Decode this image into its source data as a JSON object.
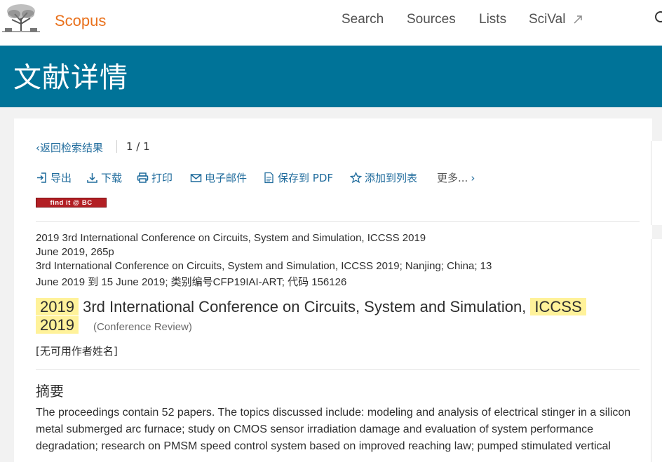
{
  "topbar": {
    "publisher_logo_icon": "elsevier-tree-icon",
    "brand": "Scopus",
    "nav": [
      "Search",
      "Sources",
      "Lists",
      "SciVal"
    ],
    "scival_icon": "external-link-icon",
    "search_icon": "search-icon",
    "accent": "#e9711c"
  },
  "banner": {
    "title": "文献详情",
    "color": "#007398"
  },
  "pager": {
    "back_label": "返回检索结果",
    "position": "1 / 1"
  },
  "actions": {
    "export": "导出",
    "download": "下载",
    "print": "打印",
    "email": "电子邮件",
    "save_pdf": "保存到 PDF",
    "add_list": "添加到列表",
    "more": "更多..."
  },
  "findit": "find it @ BC",
  "source": {
    "line1": "2019 3rd International Conference on Circuits, System and Simulation, ICCSS 2019",
    "line2": "June 2019, 265p",
    "line3": "3rd International Conference on Circuits, System and Simulation, ICCSS 2019; Nanjing; China; 13",
    "line4": "June 2019 到 15 June 2019; 类别编号CFP19IAI-ART; 代码 156126"
  },
  "document": {
    "title_hl1": "2019",
    "title_mid": "3rd International Conference on Circuits, System and Simulation,",
    "title_hl2": "ICCSS",
    "title_hl3": "2019",
    "doc_type": "(Conference Review)",
    "authors": "[无可用作者姓名]"
  },
  "abstract": {
    "heading": "摘要",
    "text": "The proceedings contain 52 papers. The topics discussed include: modeling and analysis of electrical stinger in a silicon metal submerged arc furnace; study on CMOS sensor irradiation damage and evaluation of system performance degradation; research on PMSM speed control system based on improved reaching law; pumped stimulated vertical"
  }
}
